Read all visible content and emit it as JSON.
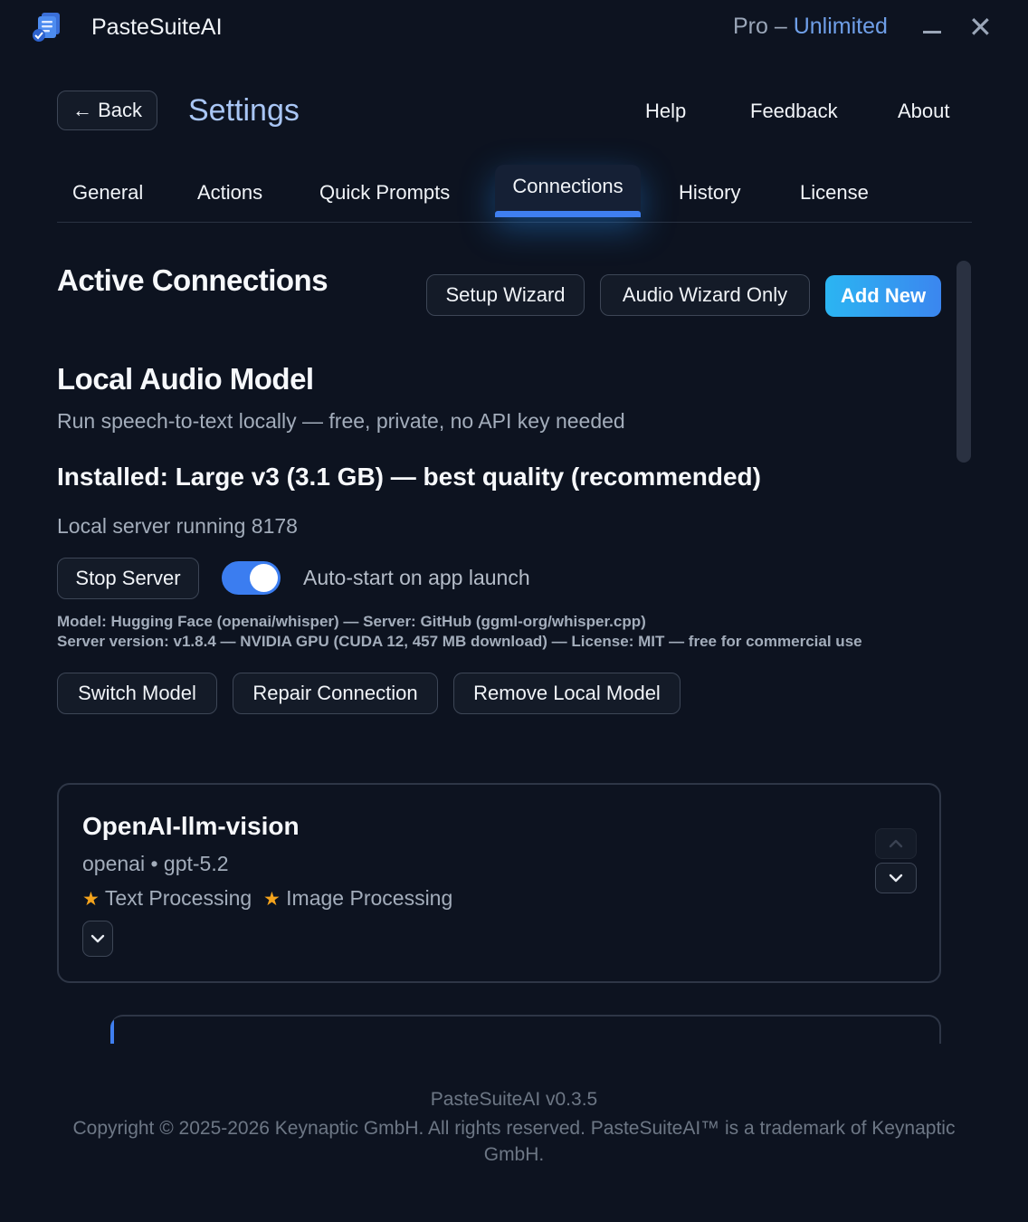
{
  "app": {
    "name": "PasteSuiteAI",
    "plan_prefix": "Pro – ",
    "plan_tier": "Unlimited",
    "minimize_icon": "minimize-icon",
    "close_glyph": "✕"
  },
  "header": {
    "back_label": "← Back",
    "title": "Settings",
    "links": [
      "Help",
      "Feedback",
      "About"
    ]
  },
  "tabs": [
    "General",
    "Actions",
    "Quick Prompts",
    "Connections",
    "History",
    "License"
  ],
  "active_tab": "Connections",
  "connections": {
    "title": "Active Connections",
    "setup_wizard": "Setup Wizard",
    "audio_wizard": "Audio Wizard Only",
    "add_new": "Add New"
  },
  "local_audio": {
    "title": "Local Audio Model",
    "subtitle": "Run speech-to-text locally — free, private, no API key needed",
    "installed": "Installed: Large v3 (3.1 GB) — best quality (recommended)",
    "status": "Local server running 8178",
    "stop_server": "Stop Server",
    "autostart_label": "Auto-start on app launch",
    "autostart_on": true,
    "meta_line1": "Model: Hugging Face (openai/whisper) — Server: GitHub (ggml-org/whisper.cpp)",
    "meta_line2": "Server version: v1.8.4 — NVIDIA GPU (CUDA 12, 457 MB download) — License: MIT — free for commercial use",
    "switch_model": "Switch Model",
    "repair_connection": "Repair Connection",
    "remove_model": "Remove Local Model"
  },
  "connection_card": {
    "name": "OpenAI-llm-vision",
    "detail": "openai • gpt-5.2",
    "tags": [
      "Text Processing",
      "Image Processing"
    ]
  },
  "footer": {
    "version": "PasteSuiteAI v0.3.5",
    "copyright": "Copyright © 2025-2026 Keynaptic GmbH. All rights reserved. PasteSuiteAI™ is a trademark of Keynaptic GmbH."
  },
  "colors": {
    "background": "#0d1320",
    "accent": "#3f7ff0",
    "accent_cyan": "#2bb5f2",
    "title_blue": "#a9c6f5",
    "star": "#f4a31c"
  }
}
